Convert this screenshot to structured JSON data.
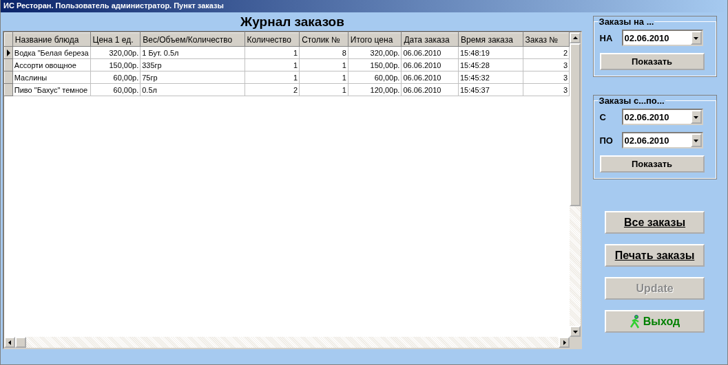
{
  "window": {
    "title": "ИС Ресторан. Пользователь администратор. Пункт заказы"
  },
  "heading": "Журнал заказов",
  "table": {
    "columns": [
      "Название блюда",
      "Цена 1 ед.",
      "Вес/Объем/Количество",
      "Количество",
      "Столик №",
      "Итого цена",
      "Дата заказа",
      "Время заказа",
      "Заказ №"
    ],
    "rows": [
      {
        "selected": true,
        "cells": [
          "Водка \"Белая береза",
          "320,00р.",
          "1 Бут. 0.5л",
          "1",
          "8",
          "320,00р.",
          "06.06.2010",
          "15:48:19",
          "2"
        ]
      },
      {
        "selected": false,
        "cells": [
          "Ассорти овощное",
          "150,00р.",
          "335гр",
          "1",
          "1",
          "150,00р.",
          "06.06.2010",
          "15:45:28",
          "3"
        ]
      },
      {
        "selected": false,
        "cells": [
          "Маслины",
          "60,00р.",
          "75гр",
          "1",
          "1",
          "60,00р.",
          "06.06.2010",
          "15:45:32",
          "3"
        ]
      },
      {
        "selected": false,
        "cells": [
          "Пиво \"Бахус\" темное",
          "60,00р.",
          "0.5л",
          "2",
          "1",
          "120,00р.",
          "06.06.2010",
          "15:45:37",
          "3"
        ]
      }
    ]
  },
  "groups": [
    {
      "title": "Заказы на ...",
      "fields": [
        {
          "label": "НА",
          "value": "02.06.2010"
        }
      ],
      "button": "Показать"
    },
    {
      "title": "Заказы с...по...",
      "fields": [
        {
          "label": "С",
          "value": "02.06.2010"
        },
        {
          "label": "ПО",
          "value": "02.06.2010"
        }
      ],
      "button": "Показать"
    }
  ],
  "buttons": [
    {
      "label": "Все заказы",
      "kind": "underlined",
      "disabled": false
    },
    {
      "label": "Печать заказы",
      "kind": "underlined",
      "disabled": false
    },
    {
      "label": "Update",
      "kind": "plain",
      "disabled": true
    },
    {
      "label": "Выход",
      "kind": "exit",
      "disabled": false
    }
  ]
}
